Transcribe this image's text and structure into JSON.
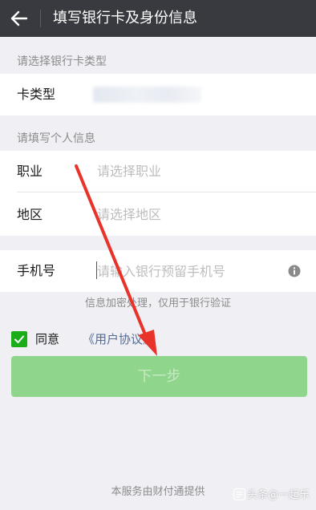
{
  "header": {
    "title": "填写银行卡及身份信息",
    "back_icon": "arrow-left-icon"
  },
  "card_section": {
    "label": "请选择银行卡类型",
    "card_type": {
      "label": "卡类型",
      "value_blurred": true
    }
  },
  "personal_section": {
    "label": "请填写个人信息",
    "job": {
      "label": "职业",
      "placeholder": "请选择职业"
    },
    "region": {
      "label": "地区",
      "placeholder": "请选择地区"
    }
  },
  "phone": {
    "label": "手机号",
    "placeholder": "请输入银行预留手机号",
    "value": "",
    "info_icon": "info-icon"
  },
  "notice": "信息加密处理，仅用于银行验证",
  "agreement": {
    "checked": true,
    "text": "同意",
    "link": "《用户协议》"
  },
  "next_button": {
    "label": "下一步",
    "enabled": false
  },
  "footer": "本服务由财付通提供",
  "watermark": "头条@一起乐",
  "colors": {
    "topbar": "#393a3f",
    "accent_green": "#1aad19",
    "button_disabled": "#8fd58b",
    "link": "#576b95",
    "annotation_arrow": "#e8332a"
  }
}
